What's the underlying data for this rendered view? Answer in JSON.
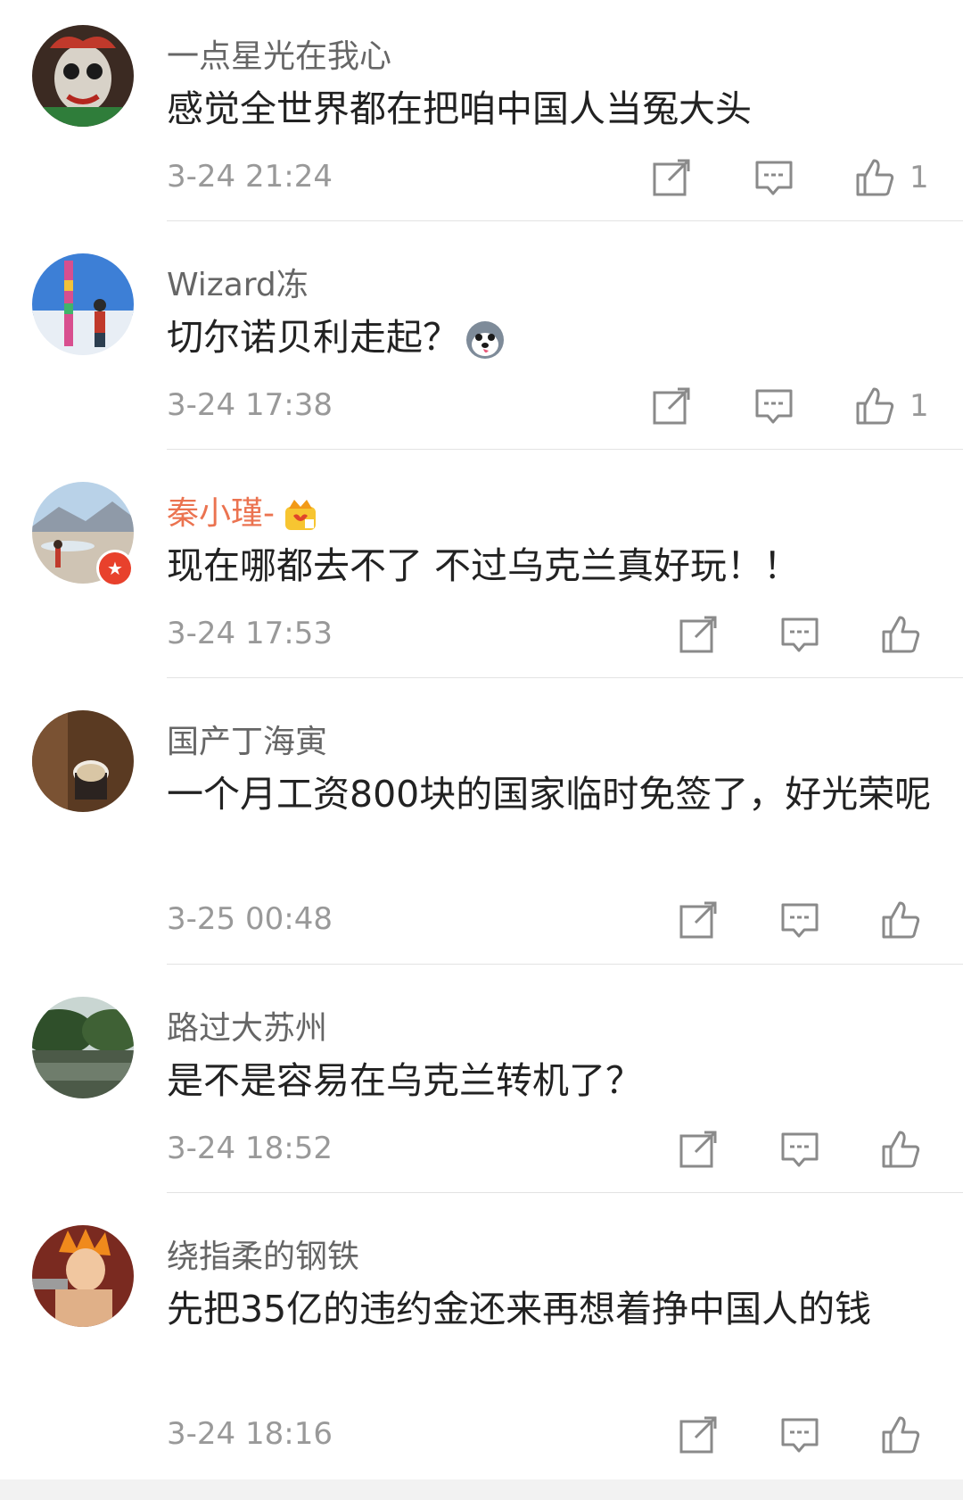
{
  "colors": {
    "text": "#222222",
    "meta": "#999999",
    "username": "#666666",
    "vip_username": "#eb7350",
    "divider": "#e3e3e3",
    "badge": "#e8412c"
  },
  "comments": [
    {
      "username": "一点星光在我心",
      "text": "感觉全世界都在把咱中国人当冤大头",
      "time": "3-24 21:24",
      "likes": "1",
      "icons": [
        "share-icon",
        "comment-icon",
        "like-icon"
      ]
    },
    {
      "username": "Wizard冻",
      "text": "切尔诺贝利走起？",
      "emoji": "husky-emoji-icon",
      "time": "3-24 17:38",
      "likes": "1",
      "icons": [
        "share-icon",
        "comment-icon",
        "like-icon"
      ]
    },
    {
      "username": "秦小瑾-",
      "vip": true,
      "badge_icon": "crown-icon",
      "text": "现在哪都去不了 不过乌克兰真好玩！！",
      "time": "3-24 17:53",
      "icons": [
        "share-icon",
        "comment-icon",
        "like-icon"
      ]
    },
    {
      "username": "国产丁海寅",
      "text": "一个月工资800块的国家临时免签了，好光荣呢",
      "time": "3-25 00:48",
      "icons": [
        "share-icon",
        "comment-icon",
        "like-icon"
      ]
    },
    {
      "username": "路过大苏州",
      "text": "是不是容易在乌克兰转机了？",
      "time": "3-24 18:52",
      "icons": [
        "share-icon",
        "comment-icon",
        "like-icon"
      ]
    },
    {
      "username": "绕指柔的钢铁",
      "text": "先把35亿的违约金还来再想着挣中国人的钱",
      "time": "3-24 18:16",
      "icons": [
        "share-icon",
        "comment-icon",
        "like-icon"
      ]
    }
  ]
}
